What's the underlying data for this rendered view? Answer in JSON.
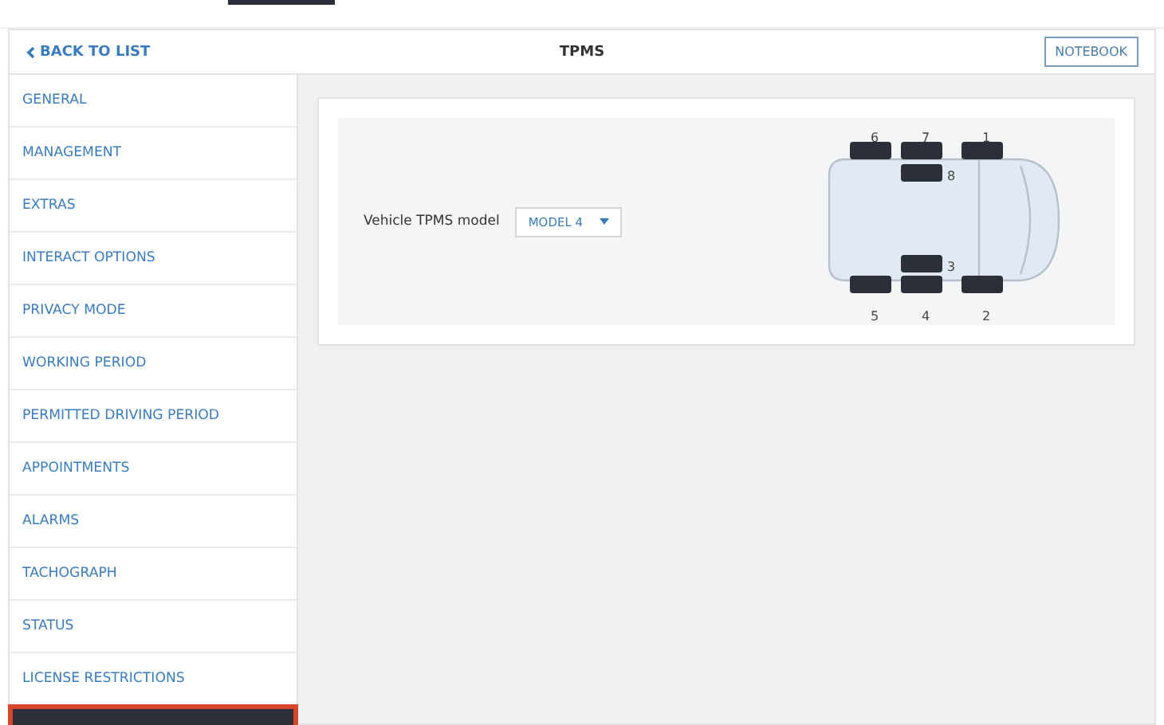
{
  "header": {
    "back_link": "BACK TO LIST",
    "title": "TPMS",
    "notebook_button": "NOTEBOOK"
  },
  "sidebar": {
    "items": [
      {
        "label": "GENERAL",
        "selected": false
      },
      {
        "label": "MANAGEMENT",
        "selected": false
      },
      {
        "label": "EXTRAS",
        "selected": false
      },
      {
        "label": "INTERACT OPTIONS",
        "selected": false
      },
      {
        "label": "PRIVACY MODE",
        "selected": false
      },
      {
        "label": "WORKING PERIOD",
        "selected": false
      },
      {
        "label": "PERMITTED DRIVING PERIOD",
        "selected": false
      },
      {
        "label": "APPOINTMENTS",
        "selected": false
      },
      {
        "label": "ALARMS",
        "selected": false
      },
      {
        "label": "TACHOGRAPH",
        "selected": false
      },
      {
        "label": "STATUS",
        "selected": false
      },
      {
        "label": "LICENSE RESTRICTIONS",
        "selected": false
      }
    ],
    "active_row": {
      "selected": true,
      "highlighted": true
    }
  },
  "tpms": {
    "model_label": "Vehicle TPMS model",
    "model_value": "MODEL 4",
    "wheels": [
      "6",
      "7",
      "1",
      "8",
      "3",
      "5",
      "4",
      "2"
    ]
  }
}
